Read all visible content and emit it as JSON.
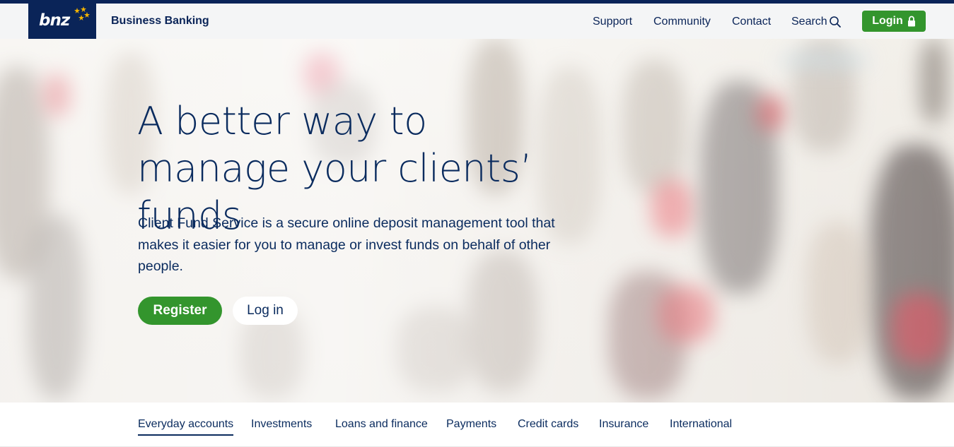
{
  "brand": {
    "logo_text": "bnz",
    "site_title": "Business Banking",
    "accent_color": "#33952d",
    "brand_color": "#0a2458"
  },
  "header": {
    "nav": [
      {
        "label": "Support"
      },
      {
        "label": "Community"
      },
      {
        "label": "Contact"
      },
      {
        "label": "Search",
        "icon": "search-icon"
      }
    ],
    "login_label": "Login",
    "login_icon": "padlock-icon"
  },
  "hero": {
    "title": "A better way to manage your clients’ funds",
    "description": "Client Fund Service is a secure online deposit management tool that makes it easier for you to manage or invest funds on behalf of other people.",
    "register_label": "Register",
    "login_label": "Log in"
  },
  "subnav": {
    "items": [
      {
        "label": "Everyday accounts",
        "active": true
      },
      {
        "label": "Investments"
      },
      {
        "label": "Loans and finance"
      },
      {
        "label": "Payments"
      },
      {
        "label": "Credit cards"
      },
      {
        "label": "Insurance"
      },
      {
        "label": "International"
      }
    ]
  }
}
